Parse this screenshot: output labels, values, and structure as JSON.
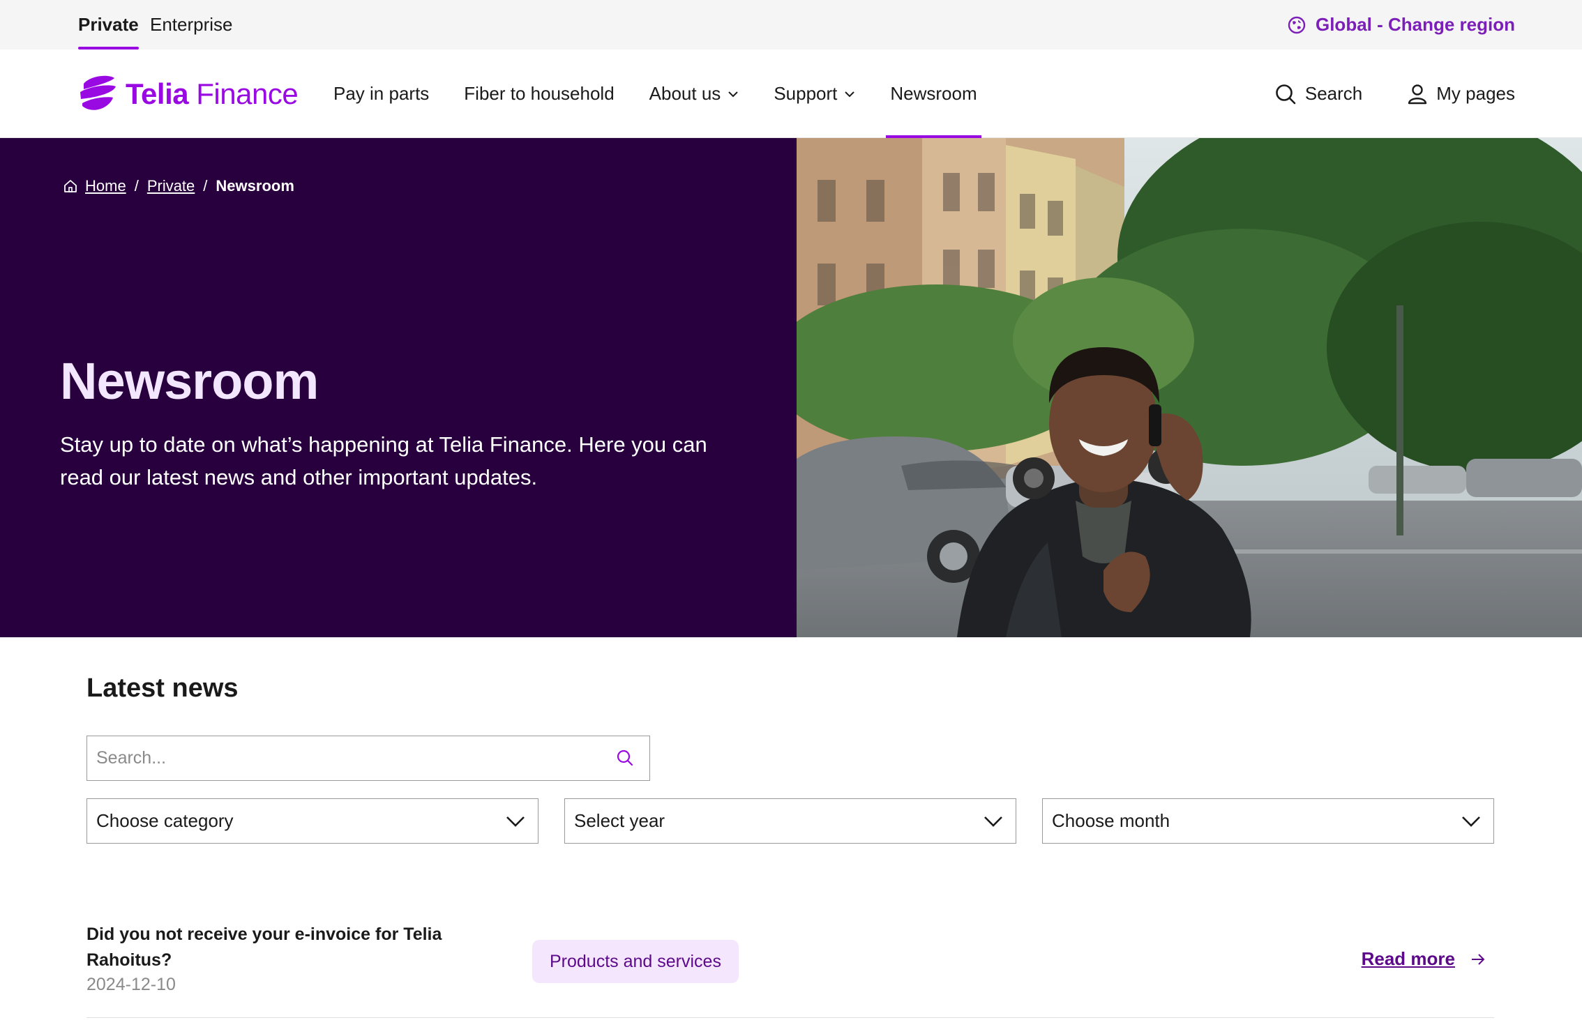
{
  "topbar": {
    "private_label": "Private",
    "enterprise_label": "Enterprise",
    "region_label": "Global - Change region"
  },
  "header": {
    "logo_text_bold": "Telia",
    "logo_text_rest": "Finance",
    "nav": [
      {
        "label": "Pay in parts"
      },
      {
        "label": "Fiber to household"
      },
      {
        "label": "About us"
      },
      {
        "label": "Support"
      },
      {
        "label": "Newsroom"
      }
    ],
    "search_label": "Search",
    "mypages_label": "My pages"
  },
  "hero": {
    "breadcrumb": {
      "home": "Home",
      "private": "Private",
      "current": "Newsroom",
      "separator": "/"
    },
    "title": "Newsroom",
    "description": "Stay up to date on what’s happening at Telia Finance. Here you can read our latest news and other important updates."
  },
  "news": {
    "title": "Latest news",
    "search_placeholder": "Search...",
    "filters": {
      "category": "Choose category",
      "year": "Select year",
      "month": "Choose month"
    },
    "items": [
      {
        "heading": "Did you not receive your e-invoice for Telia Rahoitus?",
        "date": "2024-12-10",
        "tag": "Products and services",
        "link": "Read more"
      }
    ]
  },
  "colors": {
    "brand_purple": "#990ae3",
    "hero_dark": "#29003e",
    "tag_bg": "#f4e6fc",
    "link_purple": "#5c0a8a"
  }
}
